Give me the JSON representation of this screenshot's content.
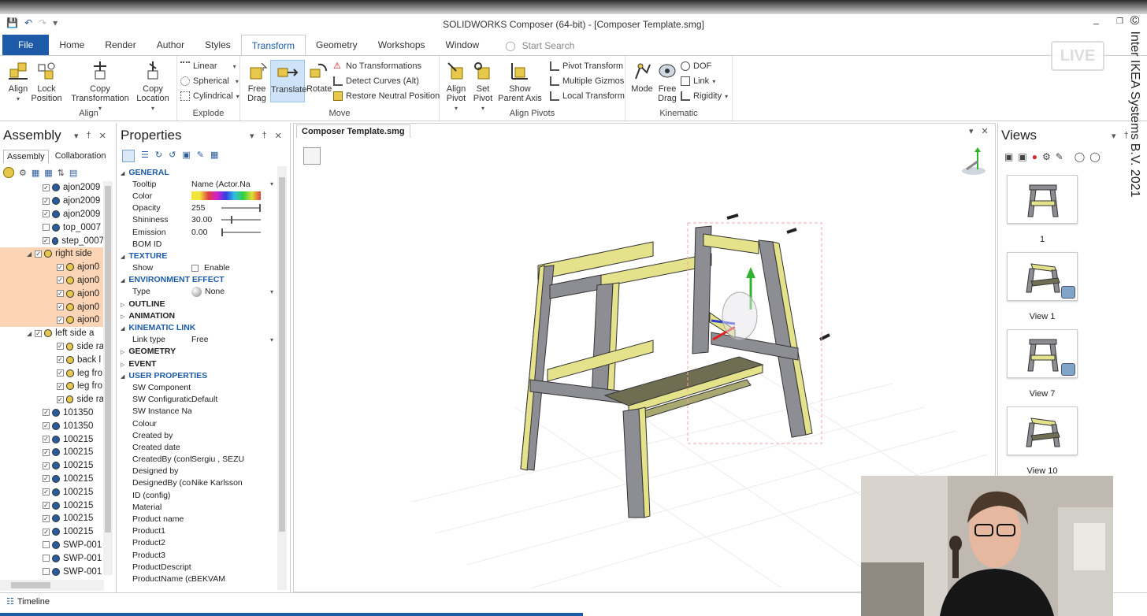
{
  "window": {
    "title": "SOLIDWORKS Composer (64-bit) - [Composer Template.smg]",
    "copyright": "© Inter IKEA Systems B.V. 2021",
    "live_badge": "LIVE"
  },
  "ribbon_tabs": [
    "File",
    "Home",
    "Render",
    "Author",
    "Styles",
    "Transform",
    "Geometry",
    "Workshops",
    "Window"
  ],
  "active_tab": "Transform",
  "search_placeholder": "Start Search",
  "ribbon": {
    "align": {
      "label": "Align",
      "align": "Align",
      "lock": "Lock Position"
    },
    "explode": {
      "label": "Explode",
      "copy_transformation": "Copy Transformation",
      "copy_location": "Copy Location",
      "linear": "Linear",
      "spherical": "Spherical",
      "cylindrical": "Cylindrical"
    },
    "move": {
      "label": "Move",
      "free_drag": "Free Drag",
      "translate": "Translate",
      "rotate": "Rotate",
      "no_transformations": "No Transformations",
      "detect_curves": "Detect Curves (Alt)",
      "restore_neutral": "Restore Neutral Position"
    },
    "align_pivots": {
      "label": "Align Pivots",
      "align_pivot": "Align Pivot",
      "set_pivot": "Set Pivot",
      "show_parent_axis": "Show Parent Axis",
      "pivot_transform": "Pivot Transform",
      "multiple_gizmos": "Multiple Gizmos",
      "local_transform": "Local Transform"
    },
    "kinematic": {
      "label": "Kinematic",
      "mode": "Mode",
      "free_drag": "Free Drag",
      "dof": "DOF",
      "link": "Link",
      "rigidity": "Rigidity"
    }
  },
  "assembly": {
    "title": "Assembly",
    "subtabs": [
      "Assembly",
      "Collaboration"
    ],
    "rows": [
      {
        "label": "ajon2009",
        "indent": 1,
        "checked": true,
        "hl": false
      },
      {
        "label": "ajon2009",
        "indent": 1,
        "checked": true,
        "hl": false
      },
      {
        "label": "ajon2009",
        "indent": 1,
        "checked": true,
        "hl": false
      },
      {
        "label": "top_0007",
        "indent": 1,
        "checked": false,
        "hl": false
      },
      {
        "label": "step_0007",
        "indent": 1,
        "checked": true,
        "hl": false
      },
      {
        "label": "right side",
        "indent": 0,
        "checked": true,
        "hl": true
      },
      {
        "label": "ajon0",
        "indent": 2,
        "checked": true,
        "hl": true
      },
      {
        "label": "ajon0",
        "indent": 2,
        "checked": true,
        "hl": true
      },
      {
        "label": "ajon0",
        "indent": 2,
        "checked": true,
        "hl": true
      },
      {
        "label": "ajon0",
        "indent": 2,
        "checked": true,
        "hl": true
      },
      {
        "label": "ajon0",
        "indent": 2,
        "checked": true,
        "hl": true
      },
      {
        "label": "left side a",
        "indent": 0,
        "checked": true,
        "hl": false
      },
      {
        "label": "side ra",
        "indent": 2,
        "checked": true,
        "hl": false
      },
      {
        "label": "back l",
        "indent": 2,
        "checked": true,
        "hl": false
      },
      {
        "label": "leg fro",
        "indent": 2,
        "checked": true,
        "hl": false
      },
      {
        "label": "leg fro",
        "indent": 2,
        "checked": true,
        "hl": false
      },
      {
        "label": "side ra",
        "indent": 2,
        "checked": true,
        "hl": false
      },
      {
        "label": "101350",
        "indent": 1,
        "checked": true,
        "hl": false
      },
      {
        "label": "101350",
        "indent": 1,
        "checked": true,
        "hl": false
      },
      {
        "label": "100215",
        "indent": 1,
        "checked": true,
        "hl": false
      },
      {
        "label": "100215",
        "indent": 1,
        "checked": true,
        "hl": false
      },
      {
        "label": "100215",
        "indent": 1,
        "checked": true,
        "hl": false
      },
      {
        "label": "100215",
        "indent": 1,
        "checked": true,
        "hl": false
      },
      {
        "label": "100215",
        "indent": 1,
        "checked": true,
        "hl": false
      },
      {
        "label": "100215",
        "indent": 1,
        "checked": true,
        "hl": false
      },
      {
        "label": "100215",
        "indent": 1,
        "checked": true,
        "hl": false
      },
      {
        "label": "100215",
        "indent": 1,
        "checked": true,
        "hl": false
      },
      {
        "label": "SWP-001",
        "indent": 1,
        "checked": false,
        "hl": false
      },
      {
        "label": "SWP-001",
        "indent": 1,
        "checked": false,
        "hl": false
      },
      {
        "label": "SWP-001",
        "indent": 1,
        "checked": false,
        "hl": false
      }
    ]
  },
  "properties": {
    "title": "Properties",
    "rows": [
      {
        "type": "sec",
        "k": "GENERAL",
        "open": true
      },
      {
        "type": "prop",
        "k": "Tooltip",
        "v": "Name (Actor.Na",
        "dd": true
      },
      {
        "type": "color",
        "k": "Color",
        "v": ""
      },
      {
        "type": "slider",
        "k": "Opacity",
        "v": "255",
        "pos": 1.0
      },
      {
        "type": "slider",
        "k": "Shininess",
        "v": "30.00",
        "pos": 0.25
      },
      {
        "type": "slider",
        "k": "Emission",
        "v": "0.00",
        "pos": 0.0
      },
      {
        "type": "prop",
        "k": "BOM ID",
        "v": ""
      },
      {
        "type": "sec",
        "k": "TEXTURE",
        "open": true
      },
      {
        "type": "check",
        "k": "Show",
        "v": "Enable"
      },
      {
        "type": "sec",
        "k": "ENVIRONMENT EFFECT",
        "open": true
      },
      {
        "type": "env",
        "k": "Type",
        "v": "None"
      },
      {
        "type": "sec",
        "k": "OUTLINE",
        "open": false,
        "dark": true
      },
      {
        "type": "sec",
        "k": "ANIMATION",
        "open": false,
        "dark": true
      },
      {
        "type": "sec",
        "k": "KINEMATIC LINK",
        "open": true
      },
      {
        "type": "prop",
        "k": "Link type",
        "v": "Free",
        "dd": true
      },
      {
        "type": "sec",
        "k": "GEOMETRY",
        "open": false,
        "dark": true
      },
      {
        "type": "sec",
        "k": "EVENT",
        "open": false,
        "dark": true
      },
      {
        "type": "sec",
        "k": "USER PROPERTIES",
        "open": true
      },
      {
        "type": "prop",
        "k": "SW Component ...",
        "v": ""
      },
      {
        "type": "prop",
        "k": "SW Configuration",
        "v": "Default"
      },
      {
        "type": "prop",
        "k": "SW Instance Name",
        "v": ""
      },
      {
        "type": "prop",
        "k": "Colour",
        "v": ""
      },
      {
        "type": "prop",
        "k": "Created by",
        "v": ""
      },
      {
        "type": "prop",
        "k": "Created date",
        "v": ""
      },
      {
        "type": "prop",
        "k": "CreatedBy (config)",
        "v": "Sergiu , SEZU"
      },
      {
        "type": "prop",
        "k": "Designed by",
        "v": ""
      },
      {
        "type": "prop",
        "k": "DesignedBy (con...",
        "v": "Nike Karlsson"
      },
      {
        "type": "prop",
        "k": "ID (config)",
        "v": ""
      },
      {
        "type": "prop",
        "k": "Material",
        "v": ""
      },
      {
        "type": "prop",
        "k": "Product name",
        "v": ""
      },
      {
        "type": "prop",
        "k": "Product1",
        "v": ""
      },
      {
        "type": "prop",
        "k": "Product2",
        "v": ""
      },
      {
        "type": "prop",
        "k": "Product3",
        "v": ""
      },
      {
        "type": "prop",
        "k": "ProductDescripti...",
        "v": ""
      },
      {
        "type": "prop",
        "k": "ProductName (co...",
        "v": "BEKVAM"
      }
    ]
  },
  "viewport": {
    "document_tab": "Composer Template.smg"
  },
  "views": {
    "title": "Views",
    "items": [
      {
        "label": "1",
        "camera": false
      },
      {
        "label": "View 1",
        "camera": true
      },
      {
        "label": "View 7",
        "camera": true
      },
      {
        "label": "View 10",
        "camera": false
      }
    ]
  },
  "status": {
    "timeline": "Timeline"
  },
  "colors": {
    "accent": "#1d5ba8",
    "highlight": "#fbd5b5",
    "wood_yellow": "#e4e28a",
    "wood_gray": "#8d8d94"
  }
}
